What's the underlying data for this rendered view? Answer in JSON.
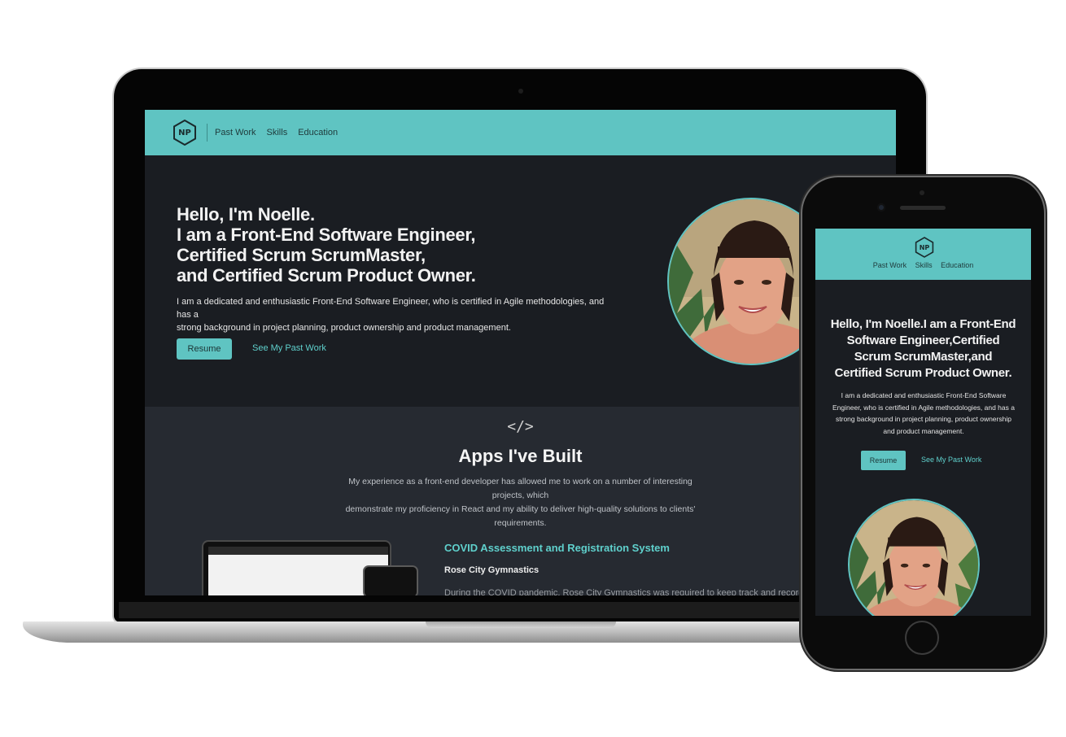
{
  "colors": {
    "accent": "#5fc4c2",
    "accent_text": "#5fd0cc",
    "hero_bg": "#1a1d22",
    "apps_bg": "#262a31"
  },
  "brand": {
    "monogram": "NP",
    "logo_icon": "hexagon-logo"
  },
  "nav": {
    "items": [
      "Past Work",
      "Skills",
      "Education"
    ]
  },
  "hero": {
    "title_lines": [
      "Hello, I'm Noelle.",
      "I am a Front-End Software Engineer,",
      "Certified Scrum ScrumMaster,",
      "and Certified Scrum Product Owner."
    ],
    "description_lines": [
      "I am a dedicated and enthusiastic Front-End Software Engineer, who is certified in Agile methodologies, and has a",
      "strong background in project planning, product ownership and product management."
    ],
    "resume_label": "Resume",
    "past_work_label": "See My Past Work"
  },
  "apps": {
    "icon": "code-icon",
    "icon_glyph": "</>",
    "title": "Apps I've Built",
    "description_lines": [
      "My experience as a front-end developer has allowed me to work on a number of interesting projects, which",
      "demonstrate my proficiency in React and my ability to deliver high-quality solutions to clients' requirements."
    ],
    "project": {
      "title": "COVID Assessment and Registration System",
      "client": "Rose City Gymnastics",
      "text": "During the COVID pandemic, Rose City Gymnastics was required to keep track and record of ev"
    }
  },
  "mobile": {
    "title_lines": [
      "Hello, I'm Noelle.I am a Front-End",
      "Software Engineer,Certified",
      "Scrum ScrumMaster,and",
      "Certified Scrum Product Owner."
    ],
    "description_lines": [
      "I am a dedicated and enthusiastic Front-End Software",
      "Engineer, who is certified in Agile methodologies, and has a",
      "strong background in project planning, product ownership",
      "and product management."
    ]
  }
}
